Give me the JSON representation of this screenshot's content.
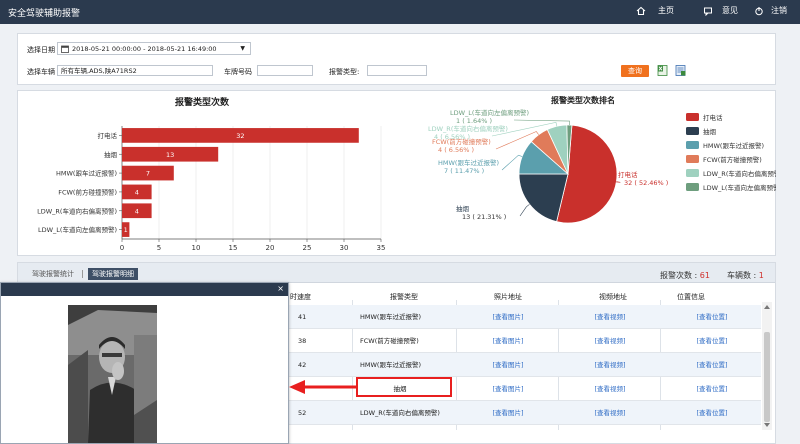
{
  "header": {
    "title": "安全驾驶辅助报警",
    "nav": [
      "主页",
      "意见",
      "注销"
    ]
  },
  "filter": {
    "date_label": "选择日期",
    "date_value": "2018-05-21 00:00:00 - 2018-05-21 16:49:00",
    "vehicle_label": "选择车辆",
    "vehicle_value": "所有车辆,ADS,陕A71RS2",
    "plate_label": "车牌号码",
    "plate_value": "",
    "alarm_type_label": "报警类型:",
    "alarm_type_value": "",
    "query_label": "查询"
  },
  "bar_title": "报警类型次数",
  "pie_title": "报警类型次数排名",
  "chart_data": [
    {
      "type": "bar",
      "orientation": "horizontal",
      "title": "报警类型次数",
      "categories": [
        "打电话",
        "抽烟",
        "HMW(跟车过近报警)",
        "FCW(前方碰撞预警)",
        "LDW_R(车道向右偏离预警)",
        "LDW_L(车道向左偏离预警)"
      ],
      "values": [
        32,
        13,
        7,
        4,
        4,
        1
      ],
      "xlim": [
        0,
        35
      ],
      "xticks": [
        0,
        5,
        10,
        15,
        20,
        25,
        30,
        35
      ],
      "color": "#c9302c",
      "grid": true
    },
    {
      "type": "pie",
      "title": "报警类型次数排名",
      "slices": [
        {
          "name": "打电话",
          "value": 32,
          "label": "32 ( 52.46% )",
          "color": "#c9302c"
        },
        {
          "name": "抽烟",
          "value": 13,
          "label": "13 ( 21.31% )",
          "color": "#2c3e50"
        },
        {
          "name": "HMW(跟车过近报警)",
          "value": 7,
          "label": "7 ( 11.47% )",
          "color": "#5b9fad"
        },
        {
          "name": "FCW(前方碰撞预警)",
          "value": 4,
          "label": "4 ( 6.56% )",
          "color": "#e07b5a"
        },
        {
          "name": "LDW_R(车道向右偏离预警)",
          "value": 4,
          "label": "4 ( 6.56% )",
          "color": "#9fd1bf"
        },
        {
          "name": "LDW_L(车道向左偏离预警)",
          "value": 1,
          "label": "1 ( 1.64% )",
          "color": "#6e9e7e"
        }
      ],
      "legend_position": "right"
    }
  ],
  "tabs": [
    "驾驶报警统计",
    "驾驶报警明细"
  ],
  "counts": {
    "alarm_label": "报警次数 :",
    "alarm_value": "61",
    "vehicle_label": "车辆数 :",
    "vehicle_value": "1"
  },
  "table": {
    "headers": [
      "时速度",
      "报警类型",
      "照片地址",
      "视频地址",
      "位置信息"
    ],
    "rows": [
      {
        "speed": "41",
        "type": "HMW(跟车过近报警)",
        "photo": "[查看图片]",
        "video": "[查看视频]",
        "location": "[查看位置]"
      },
      {
        "speed": "38",
        "type": "FCW(前方碰撞预警)",
        "photo": "[查看图片]",
        "video": "[查看视频]",
        "location": "[查看位置]"
      },
      {
        "speed": "42",
        "type": "HMW(跟车过近报警)",
        "photo": "[查看图片]",
        "video": "[查看视频]",
        "location": "[查看位置]"
      },
      {
        "speed": "",
        "type": "抽烟",
        "photo": "[查看图片]",
        "video": "[查看视频]",
        "location": "[查看位置]"
      },
      {
        "speed": "52",
        "type": "LDW_R(车道向右偏离预警)",
        "photo": "[查看图片]",
        "video": "[查看视频]",
        "location": "[查看位置]"
      }
    ]
  },
  "popup": {
    "close": "×"
  },
  "colors": {
    "header_bg": "#2b3a4e",
    "accent_red": "#c9302c",
    "query_orange": "#f0711e",
    "link_blue": "#2e6bc5",
    "highlight_red": "#e81f1f"
  }
}
